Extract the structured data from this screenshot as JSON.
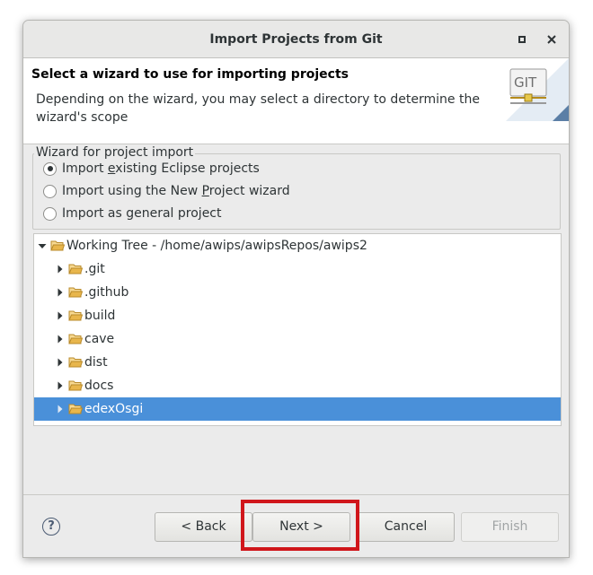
{
  "window": {
    "title": "Import Projects from Git"
  },
  "header": {
    "title": "Select a wizard to use for importing projects",
    "description": "Depending on the wizard, you may select a directory to determine the wizard's scope",
    "banner_text": "GIT"
  },
  "wizard_group": {
    "label": "Wizard for project import",
    "options": [
      {
        "pre": "Import ",
        "mnemonic": "e",
        "post": "xisting Eclipse projects",
        "checked": true
      },
      {
        "pre": "Import using the New ",
        "mnemonic": "P",
        "post": "roject wizard",
        "checked": false
      },
      {
        "pre": "Import as general project",
        "mnemonic": "",
        "post": "",
        "checked": false
      }
    ]
  },
  "tree": {
    "root": {
      "label": "Working Tree - /home/awips/awipsRepos/awips2",
      "expanded": true
    },
    "children": [
      {
        "label": ".git",
        "selected": false
      },
      {
        "label": ".github",
        "selected": false
      },
      {
        "label": "build",
        "selected": false
      },
      {
        "label": "cave",
        "selected": false
      },
      {
        "label": "dist",
        "selected": false
      },
      {
        "label": "docs",
        "selected": false
      },
      {
        "label": "edexOsgi",
        "selected": true
      }
    ]
  },
  "buttons": {
    "help": "?",
    "back": "< Back",
    "next": "Next >",
    "cancel": "Cancel",
    "finish": "Finish",
    "finish_enabled": false
  },
  "colors": {
    "selection": "#4a90d9",
    "highlight_box": "#d0161b",
    "folder": "#e8b64c"
  }
}
